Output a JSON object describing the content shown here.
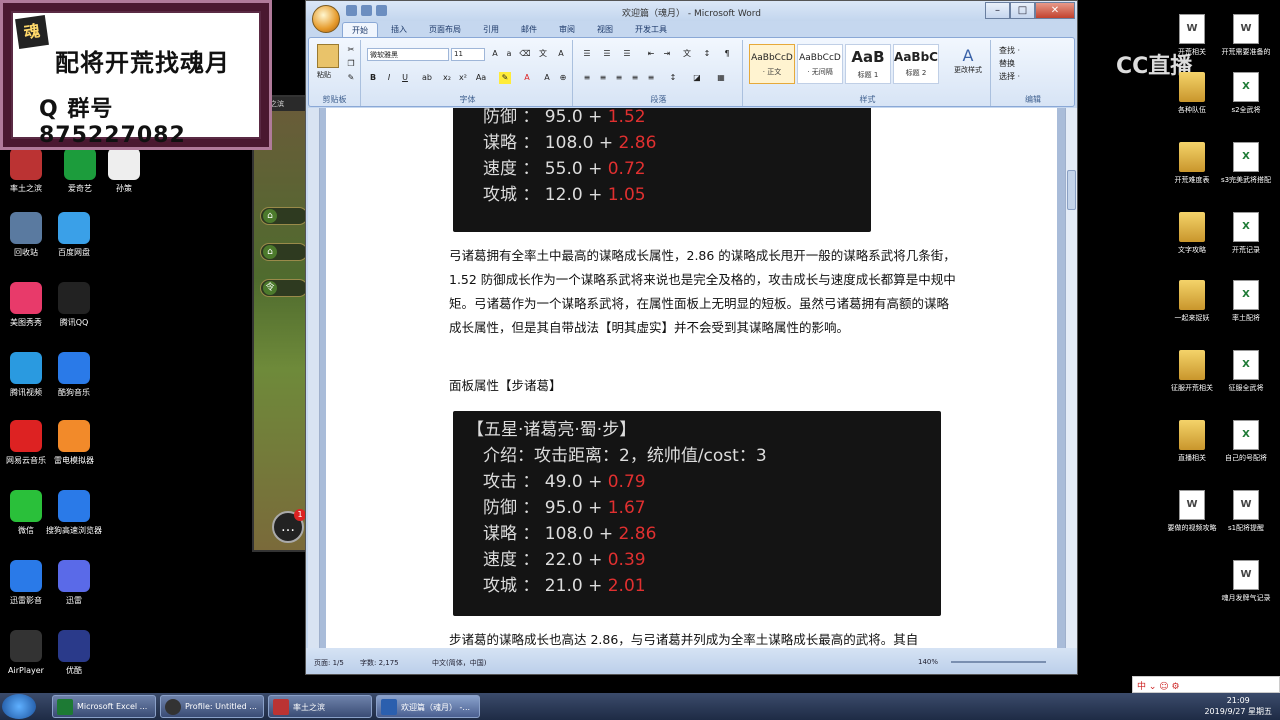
{
  "overlay": {
    "logo_char": "魂",
    "line1": "配将开荒找魂月",
    "line2": "Q 群号 875227082"
  },
  "cc_logo": "CC直播",
  "left_icons": [
    {
      "label": "率土之滨",
      "name": "shuaitu-icon"
    },
    {
      "label": "爱奇艺",
      "name": "iqiyi-icon"
    },
    {
      "label": "孙策",
      "name": "sunce-file-icon"
    },
    {
      "label": "回收站",
      "name": "recycle-bin-icon"
    },
    {
      "label": "百度网盘",
      "name": "baidu-netdisk-icon"
    },
    {
      "label": "美图秀秀",
      "name": "meitu-icon"
    },
    {
      "label": "腾讯QQ",
      "name": "qq-icon"
    },
    {
      "label": "腾讯视频",
      "name": "tencent-video-icon"
    },
    {
      "label": "酷狗音乐",
      "name": "kugou-icon"
    },
    {
      "label": "网易云音乐",
      "name": "netease-music-icon"
    },
    {
      "label": "雷电模拟器",
      "name": "leidian-icon"
    },
    {
      "label": "微信",
      "name": "wechat-icon"
    },
    {
      "label": "搜狗高速浏览器",
      "name": "sogou-browser-icon"
    },
    {
      "label": "迅雷影音",
      "name": "xunlei-player-icon"
    },
    {
      "label": "迅雷",
      "name": "xunlei-icon"
    },
    {
      "label": "AirPlayer",
      "name": "airplayer-icon"
    },
    {
      "label": "优酷",
      "name": "youku-icon"
    }
  ],
  "right_icons": [
    {
      "label": "开荒相关",
      "type": "doc"
    },
    {
      "label": "开荒需要准备的",
      "type": "doc"
    },
    {
      "label": "各种队伍",
      "type": "folder"
    },
    {
      "label": "s2全武将",
      "type": "xls"
    },
    {
      "label": "开荒难度表",
      "type": "folder"
    },
    {
      "label": "s3完美武将搭配",
      "type": "xls"
    },
    {
      "label": "文字攻略",
      "type": "folder"
    },
    {
      "label": "开荒记录",
      "type": "xls"
    },
    {
      "label": "一起来捉妖",
      "type": "folder"
    },
    {
      "label": "率土配将",
      "type": "xls"
    },
    {
      "label": "征服开荒相关",
      "type": "folder"
    },
    {
      "label": "征服全武将",
      "type": "xls"
    },
    {
      "label": "直播相关",
      "type": "folder"
    },
    {
      "label": "自己的号配将",
      "type": "xls"
    },
    {
      "label": "要做的视频攻略",
      "type": "doc"
    },
    {
      "label": "s1配将提醒",
      "type": "doc"
    },
    {
      "label": "魂月发牌气记录",
      "type": "doc"
    }
  ],
  "game": {
    "title": "率土之滨",
    "chat_badge": "1",
    "btn_icon1": "⌂",
    "btn_icon2": "令"
  },
  "word": {
    "title": "欢迎篇（魂月） - Microsoft Word",
    "tabs": [
      "开始",
      "插入",
      "页面布局",
      "引用",
      "邮件",
      "审阅",
      "视图",
      "开发工具"
    ],
    "font_name": "微软雅黑",
    "font_size": "11",
    "groups": [
      "剪贴板",
      "字体",
      "段落",
      "样式",
      "编辑"
    ],
    "paste_label": "粘贴",
    "styles": [
      {
        "preview": "AaBbCcD",
        "name": "· 正文"
      },
      {
        "preview": "AaBbCcD",
        "name": "· 无间隔"
      },
      {
        "preview": "AaB",
        "name": "标题 1"
      },
      {
        "preview": "AaBbC",
        "name": "标题 2"
      }
    ],
    "change_styles": "更改样式",
    "edit_items": [
      "查找 ·",
      "替换",
      "选择 ·"
    ],
    "status": {
      "page": "页面: 1/5",
      "words": "字数: 2,175",
      "lang": "中文(简体，中国)",
      "zoom": "140%"
    }
  },
  "doc": {
    "block1": [
      {
        "stat": "防御 ： 95.0 + ",
        "growth": "1.52"
      },
      {
        "stat": "谋略 ： 108.0 + ",
        "growth": "2.86"
      },
      {
        "stat": "速度 ： 55.0 + ",
        "growth": "0.72"
      },
      {
        "stat": "攻城 ： 12.0 + ",
        "growth": "1.05"
      }
    ],
    "para1": "弓诸葛拥有全率土中最高的谋略成长属性，2.86 的谋略成长甩开一般的谋略系武将几条街，1.52 防御成长作为一个谋略系武将来说也是完全及格的，攻击成长与速度成长都算是中规中矩。弓诸葛作为一个谋略系武将，在属性面板上无明显的短板。虽然弓诸葛拥有高额的谋略成长属性，但是其自带战法【明其虚实】并不会受到其谋略属性的影响。",
    "heading2": "面板属性【步诸葛】",
    "block2_title": "【五星·诸葛亮·蜀·步】",
    "block2_intro": "介绍：攻击距离：2，统帅值/cost：3",
    "block2": [
      {
        "stat": "攻击 ： 49.0 + ",
        "growth": "0.79"
      },
      {
        "stat": "防御 ： 95.0 + ",
        "growth": "1.67"
      },
      {
        "stat": "谋略 ： 108.0 + ",
        "growth": "2.86"
      },
      {
        "stat": "速度 ： 22.0 + ",
        "growth": "0.39"
      },
      {
        "stat": "攻城 ： 21.0 + ",
        "growth": "2.01"
      }
    ],
    "para2": "步诸葛的谋略成长也高达 2.86，与弓诸葛并列成为全率土谋略成长最高的武将。其自"
  },
  "taskbar": {
    "items": [
      "Microsoft Excel ...",
      "Profile: Untitled ...",
      "率土之滨",
      "欢迎篇（魂月） -..."
    ],
    "time": "21:09",
    "date": "2019/9/27 星期五"
  },
  "ime": "中 ⌄ ☺ ⚙"
}
